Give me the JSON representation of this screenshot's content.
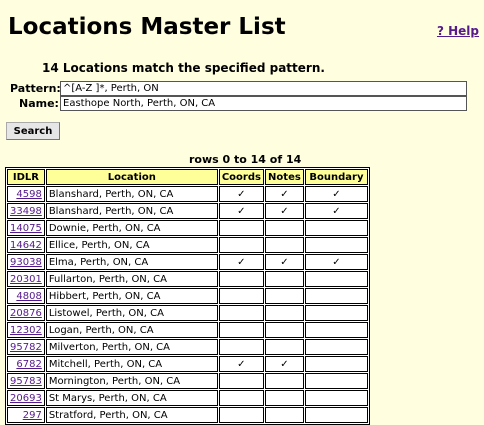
{
  "page": {
    "title": "Locations Master List",
    "help_link": "? Help",
    "match_text": "14 Locations match the specified pattern."
  },
  "form": {
    "pattern_label": "Pattern:",
    "pattern_value": "^[A-Z ]*, Perth, ON",
    "name_label": "Name:",
    "name_value": "Easthope North, Perth, ON, CA",
    "search_button": "Search"
  },
  "table": {
    "rows_info": "rows 0 to 14 of 14",
    "headers": [
      "IDLR",
      "Location",
      "Coords",
      "Notes",
      "Boundary"
    ],
    "check_glyph": "✓",
    "rows": [
      {
        "idlr": "4598",
        "location": "Blanshard, Perth, ON, CA",
        "coords": "✓",
        "notes": "✓",
        "boundary": "✓"
      },
      {
        "idlr": "33498",
        "location": "Blanshard, Perth, ON, CA",
        "coords": "✓",
        "notes": "✓",
        "boundary": "✓"
      },
      {
        "idlr": "14075",
        "location": "Downie, Perth, ON, CA",
        "coords": "",
        "notes": "",
        "boundary": ""
      },
      {
        "idlr": "14642",
        "location": "Ellice, Perth, ON, CA",
        "coords": "",
        "notes": "",
        "boundary": ""
      },
      {
        "idlr": "93038",
        "location": "Elma, Perth, ON, CA",
        "coords": "✓",
        "notes": "✓",
        "boundary": "✓"
      },
      {
        "idlr": "20301",
        "location": "Fullarton, Perth, ON, CA",
        "coords": "",
        "notes": "",
        "boundary": ""
      },
      {
        "idlr": "4808",
        "location": "Hibbert, Perth, ON, CA",
        "coords": "",
        "notes": "",
        "boundary": ""
      },
      {
        "idlr": "20876",
        "location": "Listowel, Perth, ON, CA",
        "coords": "",
        "notes": "",
        "boundary": ""
      },
      {
        "idlr": "12302",
        "location": "Logan, Perth, ON, CA",
        "coords": "",
        "notes": "",
        "boundary": ""
      },
      {
        "idlr": "95782",
        "location": "Milverton, Perth, ON, CA",
        "coords": "",
        "notes": "",
        "boundary": ""
      },
      {
        "idlr": "6782",
        "location": "Mitchell, Perth, ON, CA",
        "coords": "✓",
        "notes": "✓",
        "boundary": ""
      },
      {
        "idlr": "95783",
        "location": "Mornington, Perth, ON, CA",
        "coords": "",
        "notes": "",
        "boundary": ""
      },
      {
        "idlr": "20693",
        "location": "St Marys, Perth, ON, CA",
        "coords": "",
        "notes": "",
        "boundary": ""
      },
      {
        "idlr": "297",
        "location": "Stratford, Perth, ON, CA",
        "coords": "",
        "notes": "",
        "boundary": ""
      }
    ]
  }
}
